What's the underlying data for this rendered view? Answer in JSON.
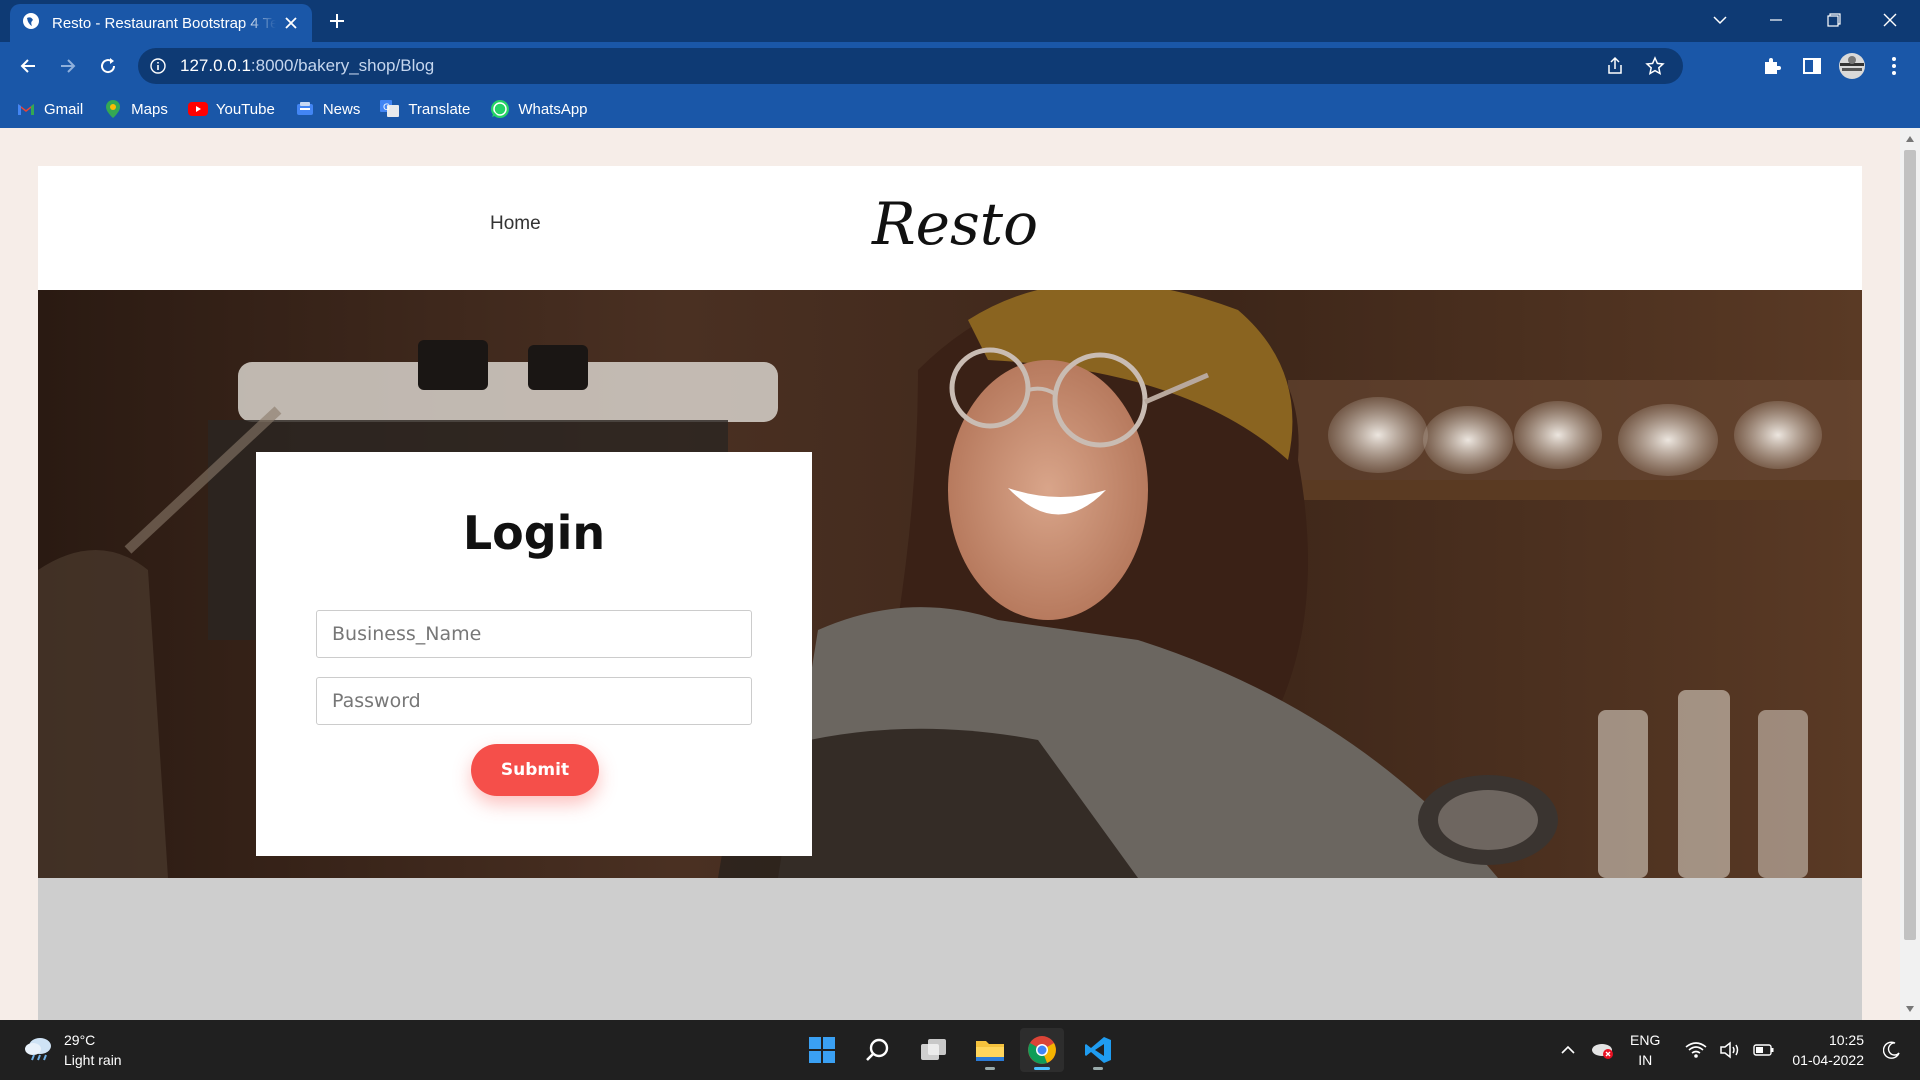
{
  "browser": {
    "tab_title": "Resto - Restaurant Bootstrap 4 Template",
    "url_host": "127.0.0.1",
    "url_path": ":8000/bakery_shop/Blog",
    "bookmarks": [
      {
        "label": "Gmail",
        "icon": "gmail-icon"
      },
      {
        "label": "Maps",
        "icon": "maps-icon"
      },
      {
        "label": "YouTube",
        "icon": "youtube-icon"
      },
      {
        "label": "News",
        "icon": "news-icon"
      },
      {
        "label": "Translate",
        "icon": "translate-icon"
      },
      {
        "label": "WhatsApp",
        "icon": "whatsapp-icon"
      }
    ]
  },
  "site": {
    "nav": {
      "home_label": "Home"
    },
    "logo_text": "Resto",
    "login": {
      "title": "Login",
      "business_placeholder": "Business_Name",
      "password_placeholder": "Password",
      "submit_label": "Submit"
    },
    "colors": {
      "accent": "#f54f4a",
      "gray_band": "#cecece",
      "page_bg": "#f6ede8"
    }
  },
  "taskbar": {
    "weather_temp": "29°C",
    "weather_desc": "Light rain",
    "lang_top": "ENG",
    "lang_bottom": "IN",
    "time": "10:25",
    "date": "01-04-2022"
  }
}
